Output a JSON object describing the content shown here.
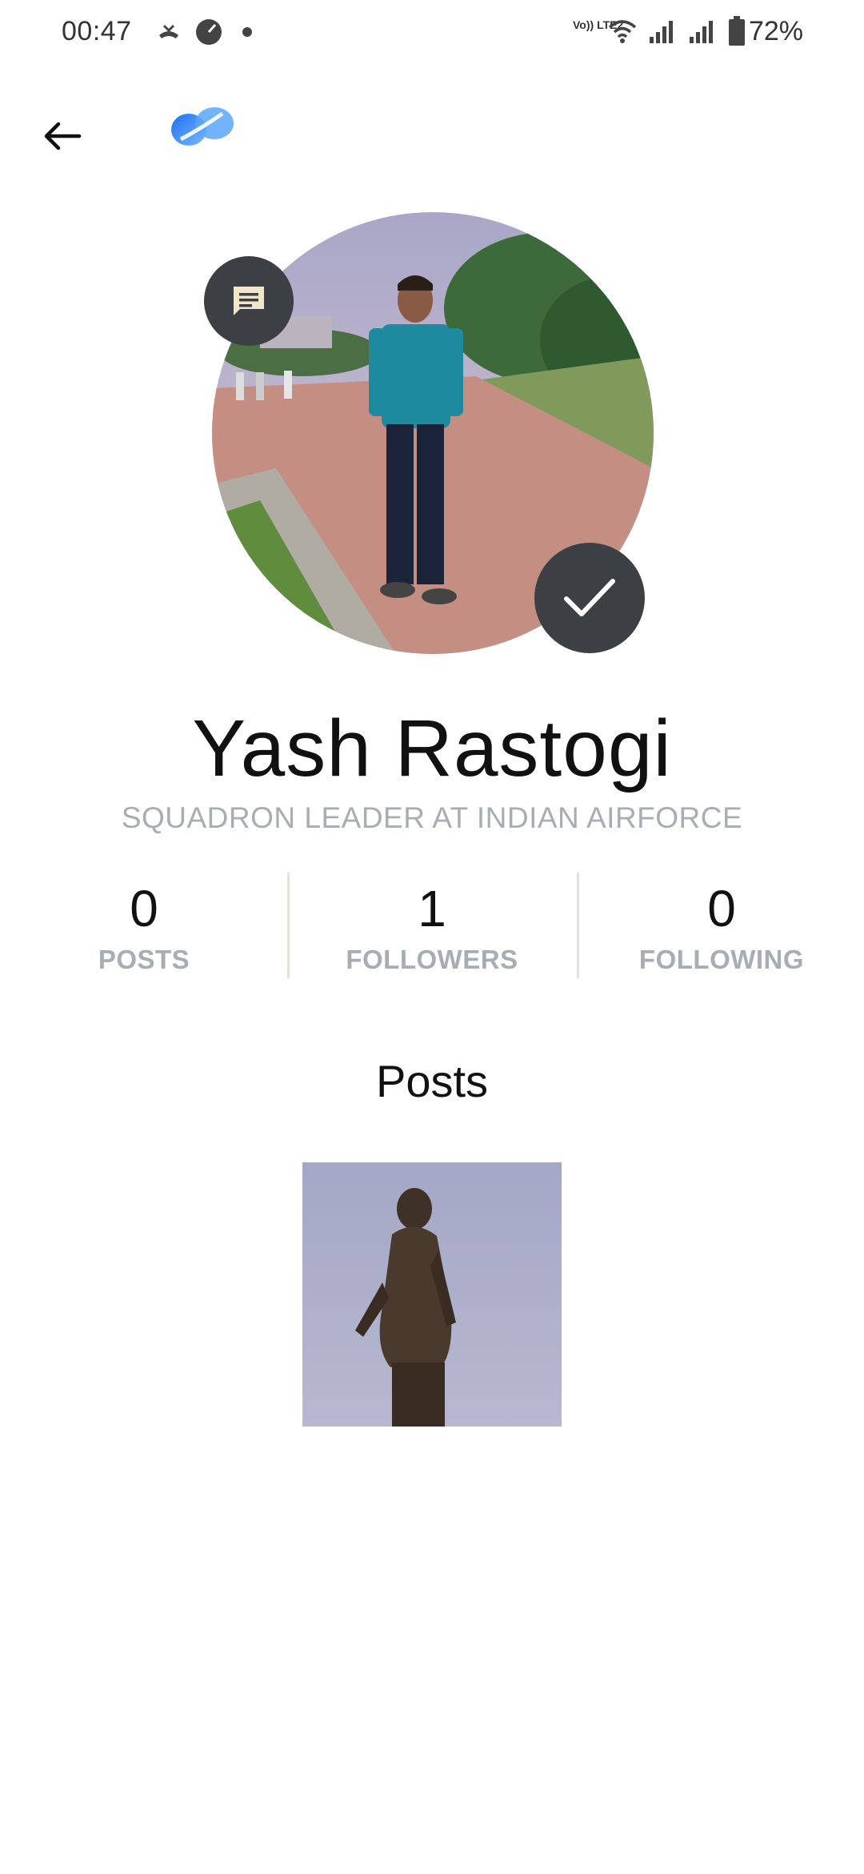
{
  "status_bar": {
    "time": "00:47",
    "volte_label": "Vo)) LTE2",
    "battery_text": "72%",
    "icons": [
      "missed-call-icon",
      "speedometer-icon",
      "dot-icon",
      "wifi-icon",
      "signal-icon",
      "signal-icon",
      "battery-icon"
    ]
  },
  "app_bar": {
    "back_icon": "arrow-left-icon",
    "logo_icon": "app-logo-icon"
  },
  "profile": {
    "name": "Yash Rastogi",
    "title": "SQUADRON LEADER AT INDIAN AIRFORCE",
    "chat_icon": "message-icon",
    "verified_icon": "checkmark-icon"
  },
  "stats": [
    {
      "value": "0",
      "label": "POSTS"
    },
    {
      "value": "1",
      "label": "FOLLOWERS"
    },
    {
      "value": "0",
      "label": "FOLLOWING"
    }
  ],
  "posts_section": {
    "heading": "Posts"
  },
  "colors": {
    "accent_blue": "#2f80ed",
    "dark_button": "#3c3f44",
    "muted_text": "#a7adb4"
  }
}
